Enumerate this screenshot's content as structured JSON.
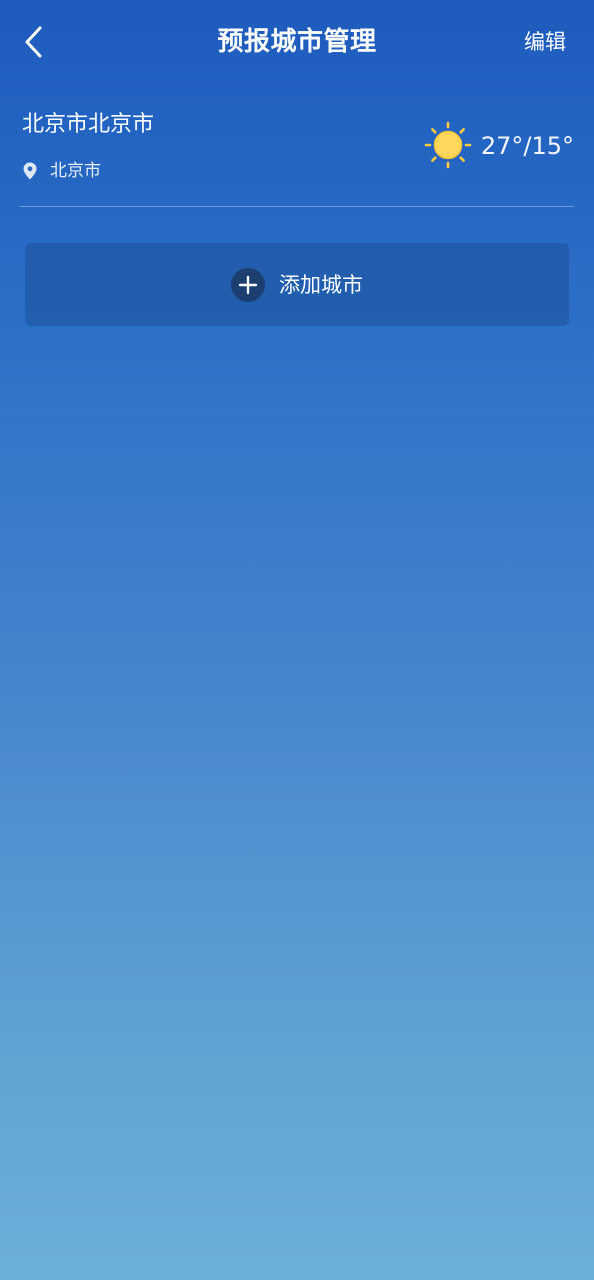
{
  "header": {
    "back_icon": "chevron-left-icon",
    "title": "预报城市管理",
    "edit_label": "编辑"
  },
  "cities": [
    {
      "name": "北京市北京市",
      "location_icon": "location-pin-icon",
      "location": "北京市",
      "weather_icon": "sun-icon",
      "temperature": "27°/15°"
    }
  ],
  "add_city": {
    "icon": "plus-icon",
    "label": "添加城市"
  },
  "colors": {
    "background_top": "#1d5bbd",
    "background_bottom": "#6bb0d8",
    "sun": "#ffc940",
    "plus_circle": "#1b3f70"
  }
}
